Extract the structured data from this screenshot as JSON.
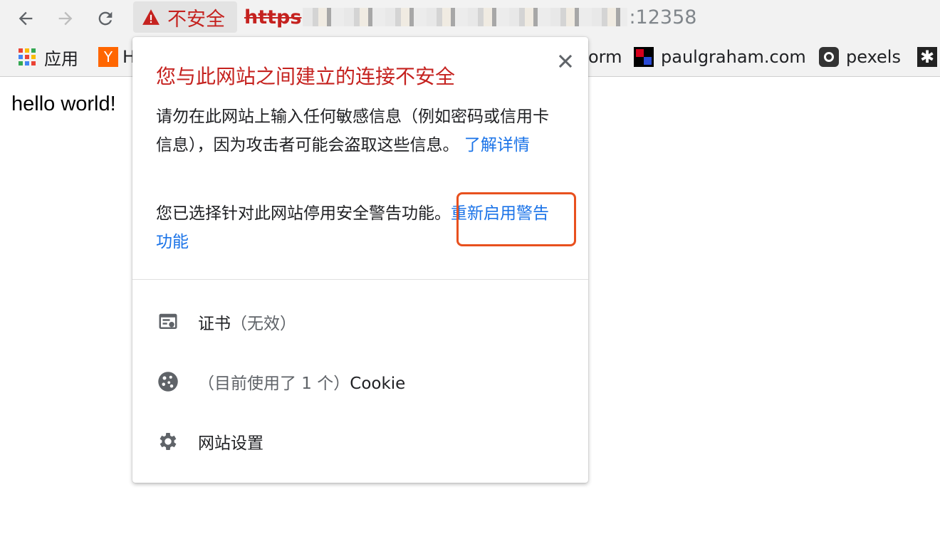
{
  "toolbar": {
    "back_icon": "arrow-left-icon",
    "forward_icon": "arrow-right-icon",
    "reload_icon": "reload-icon",
    "security_label": "不安全",
    "url_scheme": "https",
    "url_port": "12358",
    "warning_color": "#c5221f"
  },
  "bookmarks": {
    "items": [
      {
        "label": "应用",
        "icon": "apps-grid-icon"
      },
      {
        "label": "H",
        "icon": "ycombinator-icon"
      },
      {
        "label": "orm",
        "icon": ""
      },
      {
        "label": "paulgraham.com",
        "icon": "paulgraham-icon"
      },
      {
        "label": "pexels",
        "icon": "pexels-icon"
      },
      {
        "label": "",
        "icon": "star-icon"
      }
    ]
  },
  "page": {
    "text": "hello world!"
  },
  "popup": {
    "title": "您与此网站之间建立的连接不安全",
    "body_text": "请勿在此网站上输入任何敏感信息（例如密码或信用卡信息），因为攻击者可能会盗取这些信息。",
    "learn_more_link": "了解详情",
    "disabled_text": "您已选择针对此网站停用安全警告功能。",
    "reenable_link": "重新启用警告功能",
    "close_icon": "close-icon",
    "rows": [
      {
        "label": "证书",
        "muted": "（无效）",
        "icon": "certificate-icon"
      },
      {
        "label": "Cookie",
        "muted": "（目前使用了 1 个）",
        "icon": "cookie-icon"
      },
      {
        "label": "网站设置",
        "muted": "",
        "icon": "gear-icon"
      }
    ],
    "link_color": "#1a73e8",
    "highlight_color": "#e8501e"
  }
}
